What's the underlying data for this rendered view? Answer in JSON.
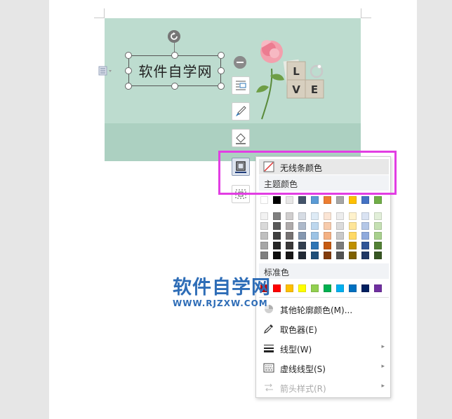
{
  "textbox": {
    "text": "软件自学网"
  },
  "banner": {
    "tile_letters": [
      "L",
      "V",
      "E"
    ]
  },
  "menu": {
    "no_line_color": "无线条颜色",
    "theme_colors_header": "主题颜色",
    "standard_colors_header": "标准色",
    "more_colors": "其他轮廓颜色(M)...",
    "eyedropper": "取色器(E)",
    "line_style": "线型(W)",
    "dash_style": "虚线线型(S)",
    "arrow_style": "箭头样式(R)",
    "theme_top_row": [
      "#ffffff",
      "#000000",
      "#e7e6e6",
      "#44546a",
      "#5b9bd5",
      "#ed7d31",
      "#a5a5a5",
      "#ffc000",
      "#4472c4",
      "#70ad47"
    ],
    "theme_shade_columns": [
      [
        "#f2f2f2",
        "#d9d9d9",
        "#bfbfbf",
        "#a6a6a6",
        "#7f7f7f"
      ],
      [
        "#7f7f7f",
        "#595959",
        "#404040",
        "#262626",
        "#0d0d0d"
      ],
      [
        "#d0cece",
        "#aeaaaa",
        "#757171",
        "#3a3838",
        "#171616"
      ],
      [
        "#d6dce4",
        "#adb9ca",
        "#8497b0",
        "#333f4f",
        "#222a35"
      ],
      [
        "#deebf6",
        "#bdd7ee",
        "#9cc3e5",
        "#2e75b5",
        "#1f4e79"
      ],
      [
        "#fbe5d5",
        "#f7cbac",
        "#f4b183",
        "#c55a11",
        "#833c0b"
      ],
      [
        "#ededed",
        "#dbdbdb",
        "#c9c9c9",
        "#7b7b7b",
        "#525252"
      ],
      [
        "#fff2cc",
        "#fee599",
        "#ffd965",
        "#bf9000",
        "#7f6000"
      ],
      [
        "#dae3f3",
        "#b4c7e7",
        "#8faadc",
        "#2f5597",
        "#203864"
      ],
      [
        "#e2efd9",
        "#c5e0b3",
        "#a8d08d",
        "#538135",
        "#375623"
      ]
    ],
    "standard_colors": [
      "#c00000",
      "#ff0000",
      "#ffc000",
      "#ffff00",
      "#92d050",
      "#00b050",
      "#00b0f0",
      "#0070c0",
      "#002060",
      "#7030a0"
    ]
  },
  "watermark": {
    "title": "软件自学网",
    "url": "WWW.RJZXW.COM"
  }
}
